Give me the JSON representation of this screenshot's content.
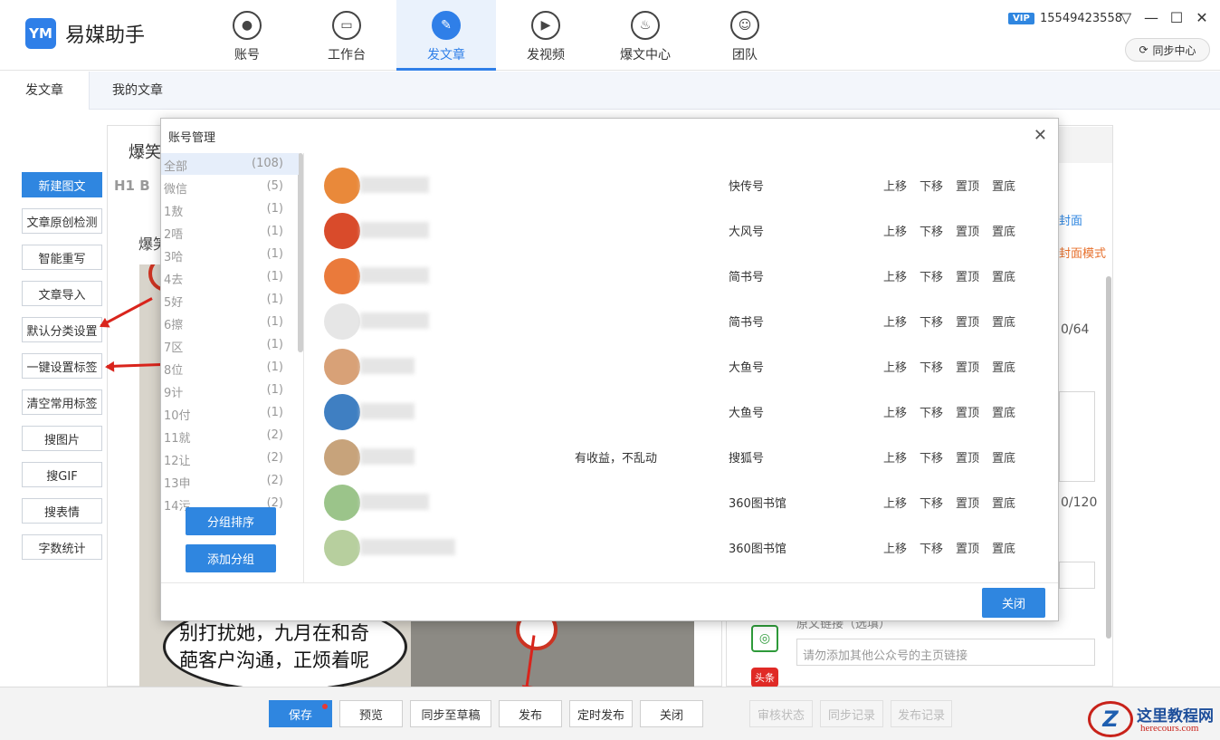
{
  "app": {
    "name": "易媒助手",
    "logo_mark": "YM"
  },
  "nav": [
    {
      "label": "账号",
      "icon": "user-icon",
      "glyph": "●"
    },
    {
      "label": "工作台",
      "icon": "monitor-icon",
      "glyph": "▭"
    },
    {
      "label": "发文章",
      "icon": "feather-icon",
      "glyph": "✎"
    },
    {
      "label": "发视频",
      "icon": "play-icon",
      "glyph": "▶"
    },
    {
      "label": "爆文中心",
      "icon": "fire-icon",
      "glyph": "♨"
    },
    {
      "label": "团队",
      "icon": "team-icon",
      "glyph": "☺"
    }
  ],
  "header": {
    "vip": "VIP",
    "phone": "15549423558",
    "sync_center": "同步中心",
    "dropdown_glyph": "▽",
    "min_glyph": "—",
    "max_glyph": "☐",
    "close_glyph": "✕"
  },
  "subtabs": [
    "发文章",
    "我的文章"
  ],
  "tools": [
    "新建图文",
    "文章原创检测",
    "智能重写",
    "文章导入",
    "默认分类设置",
    "一键设置标签",
    "清空常用标签",
    "搜图片",
    "搜GIF",
    "搜表情",
    "字数统计"
  ],
  "editor": {
    "title": "爆笑",
    "toolbar": "H1 B",
    "sub_heading": "爆笑",
    "comic_text": "别打扰她，九月在和奇葩客户沟通，正烦着呢"
  },
  "right_panel": {
    "cover_link": "封面",
    "cover_mode": "封面模式",
    "counter1": "0/64",
    "counter2": "0/120",
    "source_label": "原文链接（选填）",
    "link_placeholder": "请勿添加其他公众号的主页链接",
    "toutiao_icon_label": "头条"
  },
  "bottom": {
    "save": "保存",
    "preview": "预览",
    "sync_draft": "同步至草稿",
    "publish": "发布",
    "timed_publish": "定时发布",
    "close": "关闭",
    "review_status": "审核状态",
    "sync_log": "同步记录",
    "publish_log": "发布记录"
  },
  "watermark": {
    "mark": "Z",
    "title": "这里教程网",
    "sub": "herecours.com"
  },
  "modal": {
    "title": "账号管理",
    "close_button": "关闭",
    "group_sort": "分组排序",
    "add_group": "添加分组",
    "groups": [
      {
        "name": "全部",
        "count": "(108)"
      },
      {
        "name": "微信",
        "count": "(5)"
      },
      {
        "name": "1敖",
        "count": "(1)"
      },
      {
        "name": "2唔",
        "count": "(1)"
      },
      {
        "name": "3哈",
        "count": "(1)"
      },
      {
        "name": "4去",
        "count": "(1)"
      },
      {
        "name": "5好",
        "count": "(1)"
      },
      {
        "name": "6擦",
        "count": "(1)"
      },
      {
        "name": "7区",
        "count": "(1)"
      },
      {
        "name": "8位",
        "count": "(1)"
      },
      {
        "name": "9计",
        "count": "(1)"
      },
      {
        "name": "10付",
        "count": "(1)"
      },
      {
        "name": "11就",
        "count": "(2)"
      },
      {
        "name": "12让",
        "count": "(2)"
      },
      {
        "name": "13申",
        "count": "(2)"
      },
      {
        "name": "14污",
        "count": "(2)"
      }
    ],
    "actions": [
      "上移",
      "下移",
      "置顶",
      "置底"
    ],
    "accounts": [
      {
        "platform": "快传号",
        "note": "",
        "color": "#e9893a"
      },
      {
        "platform": "大风号",
        "note": "",
        "color": "#d94b2b"
      },
      {
        "platform": "简书号",
        "note": "",
        "color": "#ea7a3b"
      },
      {
        "platform": "简书号",
        "note": "",
        "color": "#e6e6e6"
      },
      {
        "platform": "大鱼号",
        "note": "",
        "color": "#d8a177"
      },
      {
        "platform": "大鱼号",
        "note": "",
        "color": "#3f7fc2"
      },
      {
        "platform": "搜狐号",
        "note": "有收益，不乱动",
        "color": "#c7a37b"
      },
      {
        "platform": "360图书馆",
        "note": "",
        "color": "#9bc48a"
      },
      {
        "platform": "360图书馆",
        "note": "",
        "color": "#b7cf9e"
      }
    ]
  }
}
